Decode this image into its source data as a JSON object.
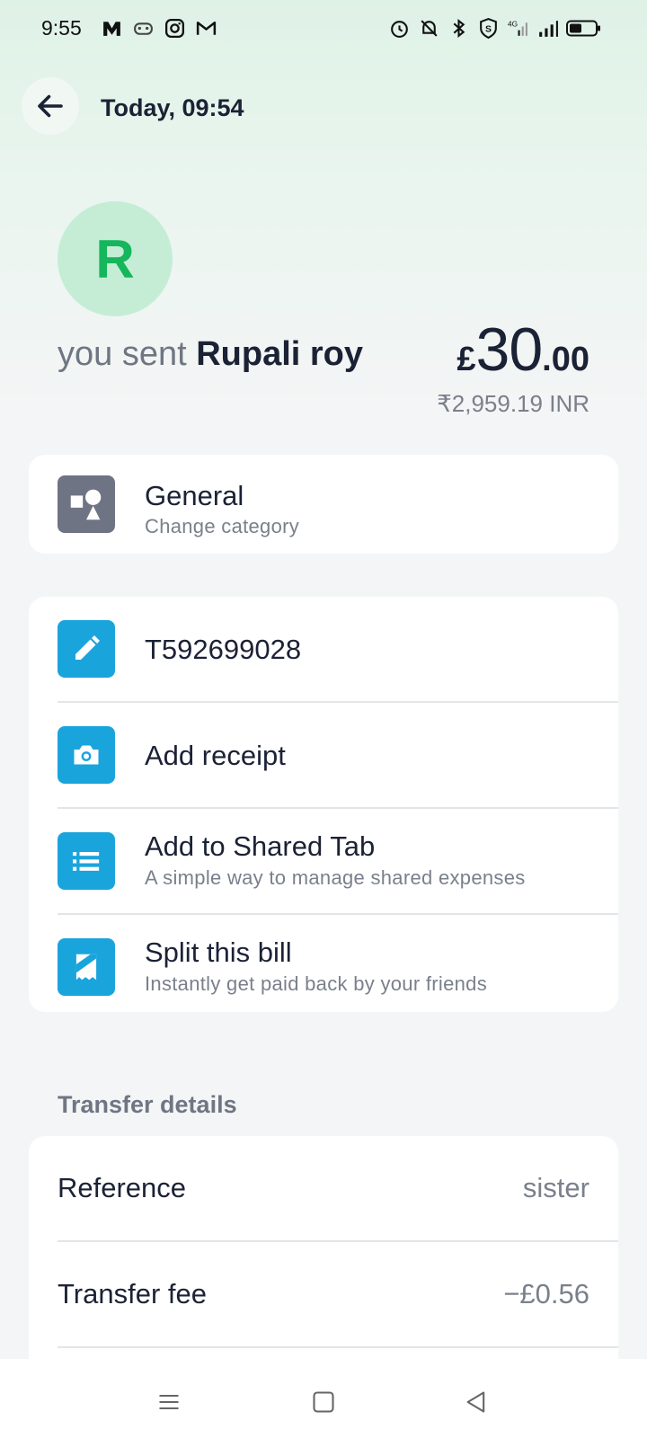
{
  "status_bar": {
    "time": "9:55",
    "left_icons": [
      "m-app-icon",
      "game-icon",
      "instagram-icon",
      "gmail-icon"
    ],
    "right_icons": [
      "alarm-icon",
      "bell-off-icon",
      "bluetooth-icon",
      "shield-icon",
      "4g-signal-icon",
      "signal-icon",
      "battery-icon"
    ]
  },
  "header": {
    "title": "Today, 09:54"
  },
  "recipient": {
    "initial": "R",
    "prefix": "you sent",
    "name": "Rupali roy"
  },
  "amount": {
    "currency": "£",
    "whole": "30",
    "decimal": ".00",
    "converted": "₹2,959.19 INR"
  },
  "category": {
    "title": "General",
    "subtitle": "Change category"
  },
  "actions": [
    {
      "title": "T592699028",
      "subtitle": ""
    },
    {
      "title": "Add receipt",
      "subtitle": ""
    },
    {
      "title": "Add to Shared Tab",
      "subtitle": "A simple way to manage shared expenses"
    },
    {
      "title": "Split this bill",
      "subtitle": "Instantly get paid back by your friends"
    }
  ],
  "transfer_details": {
    "label": "Transfer details",
    "rows": [
      {
        "label": "Reference",
        "value": "sister"
      },
      {
        "label": "Transfer fee",
        "value": "−£0.56"
      }
    ]
  },
  "colors": {
    "accent_blue": "#1aa4dc",
    "avatar_green": "#15b65c",
    "avatar_bg": "#c5edd6",
    "text_dark": "#1b2235",
    "text_muted": "#7a808b"
  }
}
